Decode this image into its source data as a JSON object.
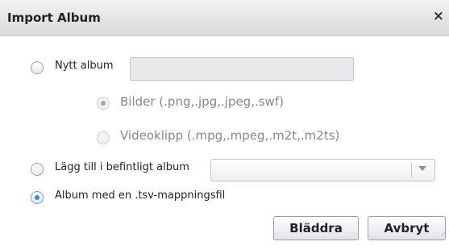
{
  "dialog": {
    "title": "Import Album",
    "close_symbol": "×"
  },
  "options": {
    "new_album": {
      "label": "Nytt album",
      "checked": false,
      "name_value": ""
    },
    "images": {
      "label": "Bilder (.png,.jpg,.jpeg,.swf)",
      "checked": true,
      "disabled": true
    },
    "videos": {
      "label": "Videoklipp (.mpg,.mpeg,.m2t,.m2ts)",
      "checked": false,
      "disabled": true
    },
    "existing_album": {
      "label": "Lägg till i befintligt album",
      "checked": false,
      "selected_value": ""
    },
    "tsv_mapping": {
      "label": "Album med en .tsv-mappningsfil",
      "checked": true
    }
  },
  "buttons": {
    "browse": "Bläddra",
    "cancel": "Avbryt"
  },
  "colors": {
    "accent": "#2e8fd6",
    "titlebar_top": "#f2f2f2",
    "titlebar_bottom": "#d9d9d9"
  }
}
